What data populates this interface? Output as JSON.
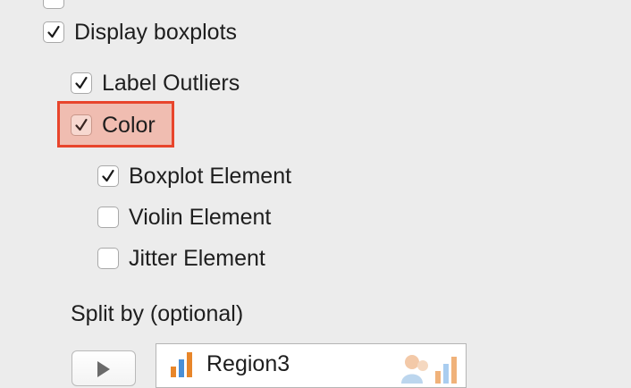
{
  "options": {
    "display_boxplots": {
      "label": "Display boxplots",
      "checked": true
    },
    "label_outliers": {
      "label": "Label Outliers",
      "checked": true
    },
    "color": {
      "label": "Color",
      "checked": true
    },
    "boxplot_element": {
      "label": "Boxplot Element",
      "checked": true
    },
    "violin_element": {
      "label": "Violin Element",
      "checked": false
    },
    "jitter_element": {
      "label": "Jitter Element",
      "checked": false
    }
  },
  "split_by": {
    "label": "Split by (optional)",
    "variable": "Region3",
    "variable_icon": "ordinal-bar-icon",
    "type_icon": "nominal-type-icon"
  },
  "colors": {
    "highlight_border": "#e8452c",
    "highlight_fill": "#f0bdb1",
    "ordinal_icon_orange": "#e8862a",
    "ordinal_icon_blue": "#4a8fd6"
  }
}
